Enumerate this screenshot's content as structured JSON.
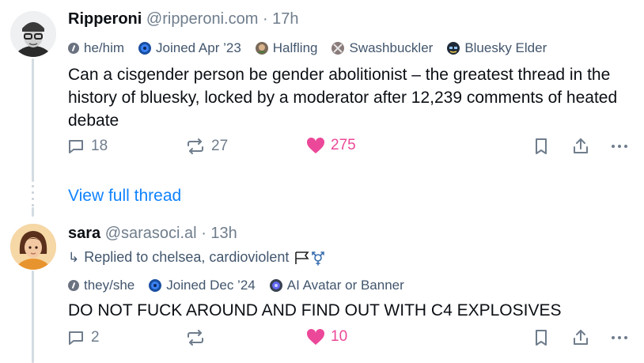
{
  "post1": {
    "author_name": "Ripperoni",
    "handle": "@ripperoni.com",
    "separator": "·",
    "time": "17h",
    "badges": [
      {
        "label": "he/him",
        "icon": "pronouns-icon"
      },
      {
        "label": "Joined Apr ’23",
        "icon": "joined-icon"
      },
      {
        "label": "Halfling",
        "icon": "halfling-icon"
      },
      {
        "label": "Swashbuckler",
        "icon": "swashbuckler-icon"
      },
      {
        "label": "Bluesky Elder",
        "icon": "elder-icon"
      }
    ],
    "text": "Can a cisgender person be gender abolitionist – the greatest thread in the history of bluesky, locked by a moderator after 12,239 comments of heated debate",
    "reply_count": "18",
    "repost_count": "27",
    "like_count": "275"
  },
  "view_full_thread": "View full thread",
  "post2": {
    "author_name": "sara",
    "handle": "@sarasoci.al",
    "separator": "·",
    "time": "13h",
    "replied_to": "Replied to chelsea, cardioviolent",
    "badges": [
      {
        "label": "they/she",
        "icon": "pronouns-icon"
      },
      {
        "label": "Joined Dec ’24",
        "icon": "joined-icon"
      },
      {
        "label": "AI Avatar or Banner",
        "icon": "ai-icon"
      }
    ],
    "text": "DO NOT FUCK AROUND AND FIND OUT WITH C4 EXPLOSIVES",
    "reply_count": "2",
    "repost_count": "",
    "like_count": "10"
  },
  "colors": {
    "accent": "#1083fe",
    "like": "#ec4899",
    "muted": "#6f7d8c",
    "badge_text": "#42566d"
  }
}
